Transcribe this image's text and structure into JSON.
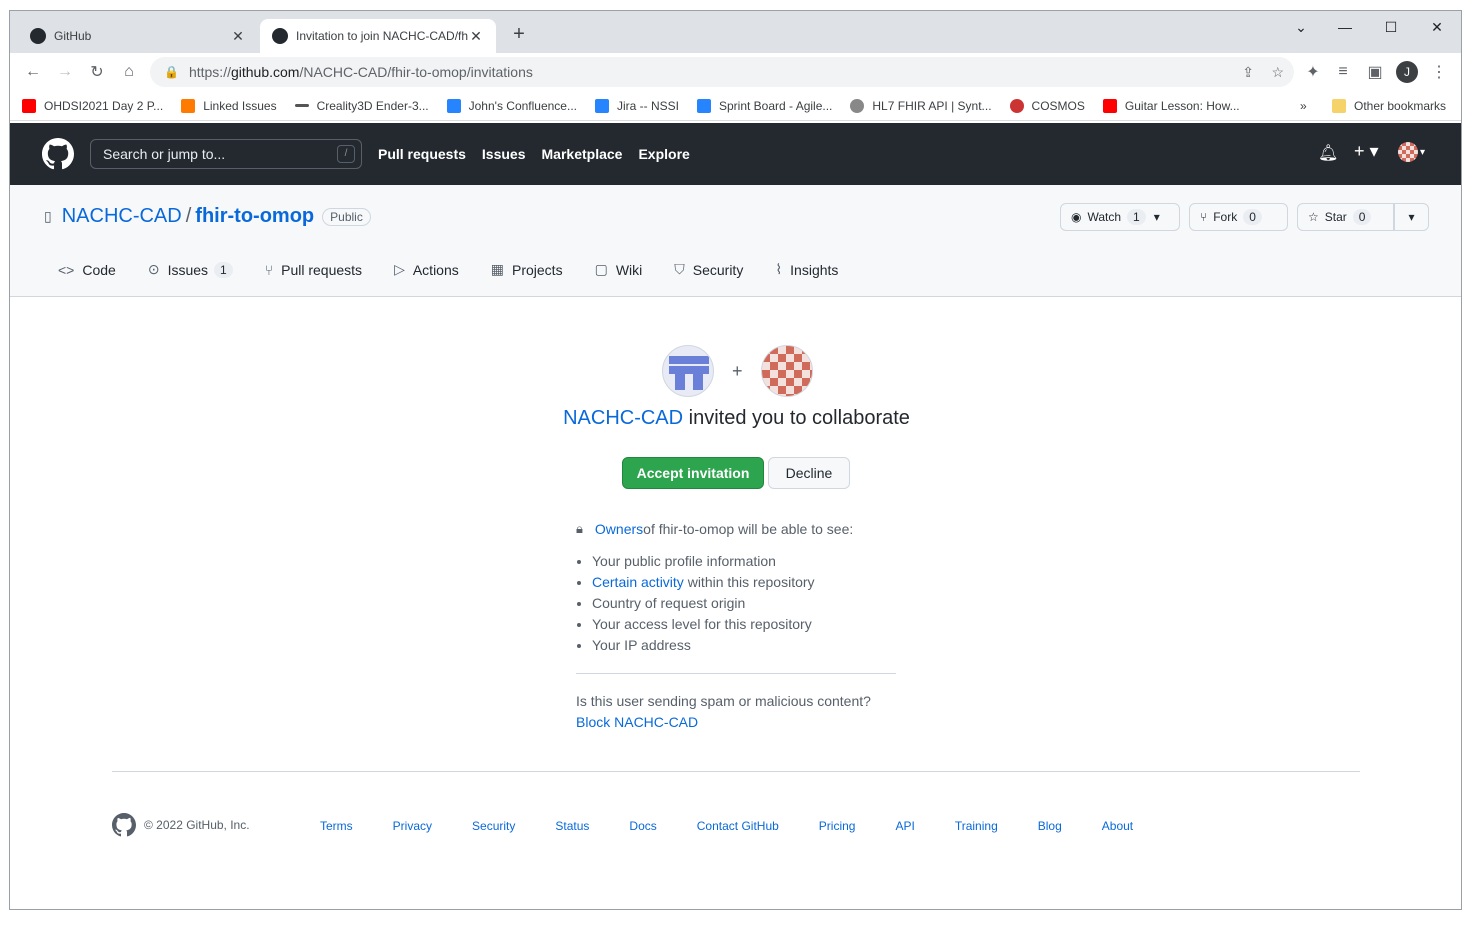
{
  "browser": {
    "tabs": [
      {
        "title": "GitHub"
      },
      {
        "title": "Invitation to join NACHC-CAD/fh"
      }
    ],
    "url_prefix": "https://",
    "url_host": "github.com",
    "url_path": "/NACHC-CAD/fhir-to-omop/invitations",
    "profile_initial": "J",
    "bookmarks": [
      {
        "label": "OHDSI2021 Day 2 P...",
        "color": "#ff0000"
      },
      {
        "label": "Linked Issues",
        "color": "#ff7a00"
      },
      {
        "label": "Creality3D Ender-3...",
        "color": "#555555"
      },
      {
        "label": "John's Confluence...",
        "color": "#2684ff"
      },
      {
        "label": "Jira -- NSSI",
        "color": "#2684ff"
      },
      {
        "label": "Sprint Board - Agile...",
        "color": "#2684ff"
      },
      {
        "label": "HL7 FHIR API | Synt...",
        "color": "#888888"
      },
      {
        "label": "COSMOS",
        "color": "#cc3333"
      },
      {
        "label": "Guitar Lesson: How...",
        "color": "#ff0000"
      }
    ],
    "more_bookmarks": "»",
    "other_bookmarks": "Other bookmarks"
  },
  "gh_header": {
    "search_placeholder": "Search or jump to...",
    "search_key": "/",
    "nav": [
      "Pull requests",
      "Issues",
      "Marketplace",
      "Explore"
    ]
  },
  "repo": {
    "owner": "NACHC-CAD",
    "separator": "/",
    "name": "fhir-to-omop",
    "visibility": "Public",
    "watch_label": "Watch",
    "watch_count": "1",
    "fork_label": "Fork",
    "fork_count": "0",
    "star_label": "Star",
    "star_count": "0",
    "tabs": [
      {
        "label": "Code",
        "icon": "<>",
        "count": ""
      },
      {
        "label": "Issues",
        "icon": "⊙",
        "count": "1"
      },
      {
        "label": "Pull requests",
        "icon": "⑂",
        "count": ""
      },
      {
        "label": "Actions",
        "icon": "▷",
        "count": ""
      },
      {
        "label": "Projects",
        "icon": "▦",
        "count": ""
      },
      {
        "label": "Wiki",
        "icon": "▢",
        "count": ""
      },
      {
        "label": "Security",
        "icon": "⛉",
        "count": ""
      },
      {
        "label": "Insights",
        "icon": "⌇",
        "count": ""
      }
    ]
  },
  "invite": {
    "plus": "+",
    "inviter": "NACHC-CAD",
    "text": " invited you to collaborate",
    "accept": "Accept invitation",
    "decline": "Decline",
    "owners_link": "Owners",
    "owners_text": " of fhir-to-omop will be able to see:",
    "see_items": [
      {
        "link": "",
        "text": "Your public profile information"
      },
      {
        "link": "Certain activity",
        "text": " within this repository"
      },
      {
        "link": "",
        "text": "Country of request origin"
      },
      {
        "link": "",
        "text": "Your access level for this repository"
      },
      {
        "link": "",
        "text": "Your IP address"
      }
    ],
    "spam_question": "Is this user sending spam or malicious content?",
    "block": "Block NACHC-CAD"
  },
  "footer": {
    "copyright": "© 2022 GitHub, Inc.",
    "links": [
      "Terms",
      "Privacy",
      "Security",
      "Status",
      "Docs",
      "Contact GitHub",
      "Pricing",
      "API",
      "Training",
      "Blog",
      "About"
    ]
  }
}
